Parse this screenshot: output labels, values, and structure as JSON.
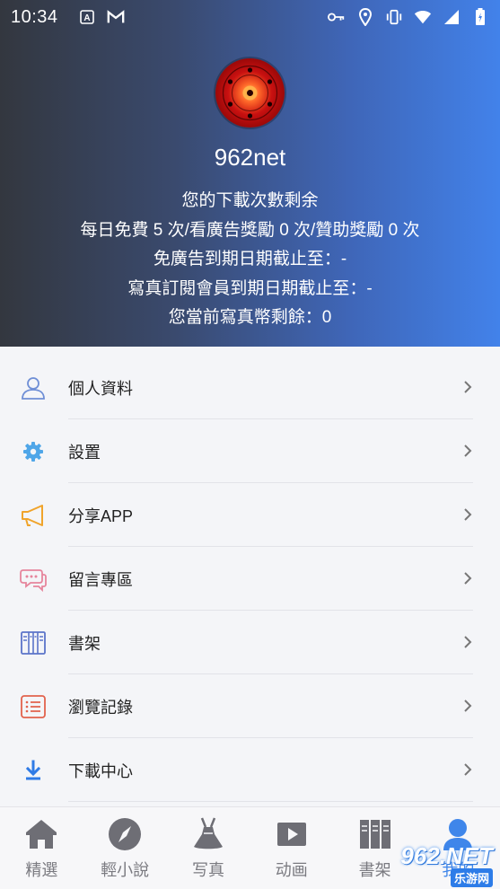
{
  "status_bar": {
    "time": "10:34",
    "left_icons": [
      "font-a-icon",
      "gmail-icon"
    ],
    "right_icons": [
      "key-icon",
      "location-icon",
      "vibrate-icon",
      "wifi-icon",
      "signal-icon",
      "battery-charging-icon"
    ]
  },
  "profile": {
    "username": "962net",
    "lines": [
      "您的下載次數剩余",
      "每日免費 5 次/看廣告獎勵 0 次/贊助獎勵 0 次",
      "免廣告到期日期截止至：-",
      "寫真訂閱會員到期日期截止至：-",
      "您當前寫真幣剩餘：0"
    ]
  },
  "menu": {
    "items": [
      {
        "label": "個人資料",
        "icon": "user-icon"
      },
      {
        "label": "設置",
        "icon": "gear-icon"
      },
      {
        "label": "分享APP",
        "icon": "megaphone-icon"
      },
      {
        "label": "留言專區",
        "icon": "chat-bubbles-icon"
      },
      {
        "label": "書架",
        "icon": "bookshelf-icon"
      },
      {
        "label": "瀏覽記錄",
        "icon": "history-list-icon"
      },
      {
        "label": "下載中心",
        "icon": "download-icon"
      }
    ]
  },
  "tabbar": {
    "tabs": [
      {
        "label": "精選",
        "icon": "home-icon"
      },
      {
        "label": "輕小說",
        "icon": "compass-icon"
      },
      {
        "label": "写真",
        "icon": "dress-icon"
      },
      {
        "label": "动画",
        "icon": "play-icon"
      },
      {
        "label": "書架",
        "icon": "books-icon"
      },
      {
        "label": "我的",
        "icon": "person-icon"
      }
    ],
    "active_index": 5
  },
  "watermark": {
    "brand": "962.NET",
    "sub": "乐游网"
  },
  "colors": {
    "accent": "#3f86ea",
    "header_start": "#33373f",
    "header_end": "#4282ea"
  }
}
